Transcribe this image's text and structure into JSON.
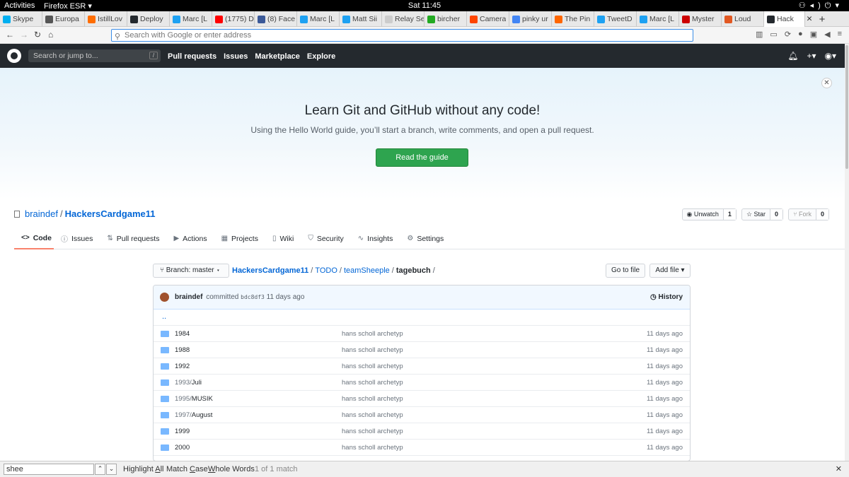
{
  "system": {
    "activities": "Activities",
    "app": "Firefox ESR",
    "clock": "Sat 11:45"
  },
  "tabs": [
    {
      "label": "Skype",
      "color": "#00aff0"
    },
    {
      "label": "Europa",
      "color": "#555555"
    },
    {
      "label": "IstillLov",
      "color": "#ff6d00"
    },
    {
      "label": "Deploy",
      "color": "#24292e"
    },
    {
      "label": "Marc [L",
      "color": "#1da1f2"
    },
    {
      "label": "(1775) D",
      "color": "#ff0000"
    },
    {
      "label": "(8) Face",
      "color": "#3b5998"
    },
    {
      "label": "Marc [L",
      "color": "#1da1f2"
    },
    {
      "label": "Matt Sii",
      "color": "#1da1f2"
    },
    {
      "label": "Relay Searc",
      "color": "#cccccc"
    },
    {
      "label": "bircher",
      "color": "#22aa22"
    },
    {
      "label": "Camera",
      "color": "#ff4500"
    },
    {
      "label": "pinky ur",
      "color": "#4285f4"
    },
    {
      "label": "The Pin",
      "color": "#ff6600"
    },
    {
      "label": "TweetD",
      "color": "#1da1f2"
    },
    {
      "label": "Marc [L",
      "color": "#1da1f2"
    },
    {
      "label": "Myster",
      "color": "#cc0000"
    },
    {
      "label": "Loud",
      "color": "#e25822"
    },
    {
      "label": "Hack",
      "color": "#24292e"
    }
  ],
  "address": {
    "placeholder": "Search with Google or enter address"
  },
  "github": {
    "search_placeholder": "Search or jump to...",
    "nav": [
      "Pull requests",
      "Issues",
      "Marketplace",
      "Explore"
    ]
  },
  "banner": {
    "title": "Learn Git and GitHub without any code!",
    "subtitle": "Using the Hello World guide, you’ll start a branch, write comments, and open a pull request.",
    "button": "Read the guide"
  },
  "repo": {
    "owner": "braindef",
    "name": "HackersCardgame11",
    "watch_label": "Unwatch",
    "watch_count": "1",
    "star_label": "Star",
    "star_count": "0",
    "fork_label": "Fork",
    "fork_count": "0"
  },
  "repo_tabs": [
    "Code",
    "Issues",
    "Pull requests",
    "Actions",
    "Projects",
    "Wiki",
    "Security",
    "Insights",
    "Settings"
  ],
  "file_nav": {
    "branch": "Branch: master",
    "crumbs": [
      "HackersCardgame11",
      "TODO",
      "teamSheeple"
    ],
    "current": "tagebuch",
    "go_to_file": "Go to file",
    "add_file": "Add file"
  },
  "commit": {
    "author": "braindef",
    "verb": "committed",
    "sha": "bdc8df3",
    "age": "11 days ago",
    "history": "History"
  },
  "updir": "..",
  "files": [
    {
      "dir": "",
      "name": "1984",
      "msg": "hans scholl archetyp",
      "age": "11 days ago"
    },
    {
      "dir": "",
      "name": "1988",
      "msg": "hans scholl archetyp",
      "age": "11 days ago"
    },
    {
      "dir": "",
      "name": "1992",
      "msg": "hans scholl archetyp",
      "age": "11 days ago"
    },
    {
      "dir": "1993/",
      "name": "Juli",
      "msg": "hans scholl archetyp",
      "age": "11 days ago"
    },
    {
      "dir": "1995/",
      "name": "MUSIK",
      "msg": "hans scholl archetyp",
      "age": "11 days ago"
    },
    {
      "dir": "1997/",
      "name": "August",
      "msg": "hans scholl archetyp",
      "age": "11 days ago"
    },
    {
      "dir": "",
      "name": "1999",
      "msg": "hans scholl archetyp",
      "age": "11 days ago"
    },
    {
      "dir": "",
      "name": "2000",
      "msg": "hans scholl archetyp",
      "age": "11 days ago"
    }
  ],
  "findbar": {
    "query": "shee",
    "highlight_prefix": "Highlight ",
    "highlight_key": "A",
    "highlight_suffix": "ll",
    "matchcase_prefix": "Match ",
    "matchcase_key": "C",
    "matchcase_suffix": "ase",
    "whole_key": "W",
    "whole_suffix": "hole Words",
    "count": "1 of 1 match"
  }
}
